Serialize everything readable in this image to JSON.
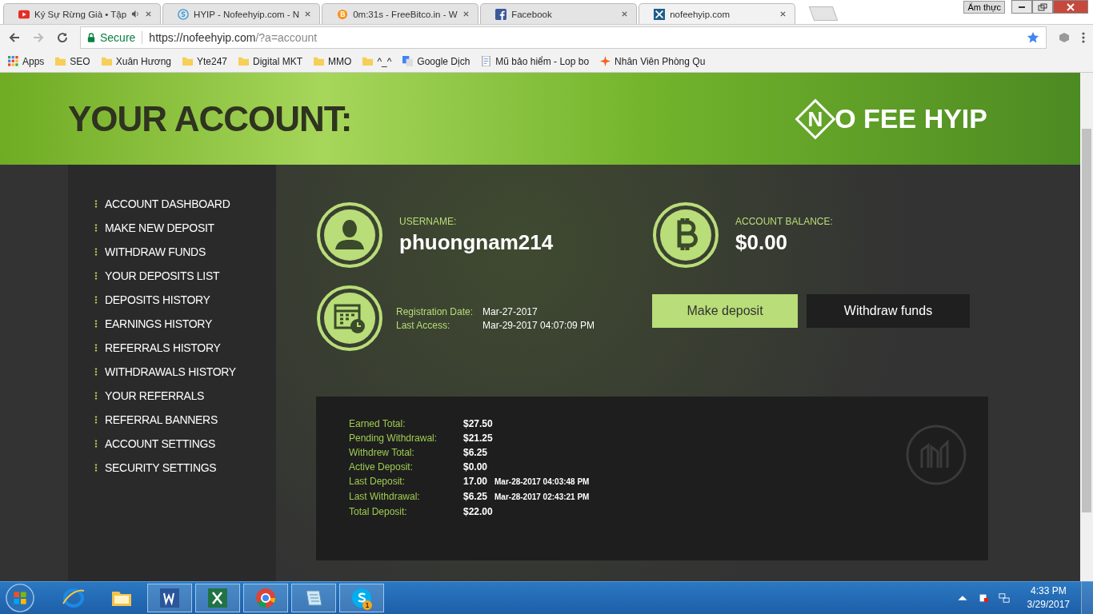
{
  "browser": {
    "tabs": [
      {
        "kind": "youtube",
        "title": "Ký Sự Rừng Già • Tập",
        "audio": true,
        "selected": false
      },
      {
        "kind": "s-logo",
        "title": "HYIP - Nofeehyip.com - N",
        "audio": false,
        "selected": false
      },
      {
        "kind": "bitcoin",
        "title": "0m:31s - FreeBitco.in - W",
        "audio": false,
        "selected": false
      },
      {
        "kind": "facebook",
        "title": "Facebook",
        "audio": false,
        "selected": false
      },
      {
        "kind": "x-logo",
        "title": "nofeehyip.com",
        "audio": false,
        "selected": true
      }
    ],
    "profile": "Ẩm thực",
    "secure": "Secure",
    "url_host": "https://nofeehyip.com",
    "url_path": "/?a=account",
    "bookmarks": [
      {
        "kind": "apps",
        "label": "Apps"
      },
      {
        "kind": "folder",
        "label": "SEO"
      },
      {
        "kind": "folder",
        "label": "Xuân Hương"
      },
      {
        "kind": "folder",
        "label": "Yte247"
      },
      {
        "kind": "folder",
        "label": "Digital MKT"
      },
      {
        "kind": "folder",
        "label": "MMO"
      },
      {
        "kind": "folder",
        "label": "^_^"
      },
      {
        "kind": "translate",
        "label": "Google Dịch"
      },
      {
        "kind": "page",
        "label": "Mũ bảo hiểm - Lop bo"
      },
      {
        "kind": "star",
        "label": "Nhân Viên Phòng Qu"
      }
    ]
  },
  "header": {
    "title": "YOUR ACCOUNT:",
    "logo_mark": "N",
    "logo_text": "O FEE HYIP"
  },
  "sidebar": {
    "items": [
      "ACCOUNT DASHBOARD",
      "MAKE NEW DEPOSIT",
      "WITHDRAW FUNDS",
      "YOUR DEPOSITS LIST",
      "DEPOSITS HISTORY",
      "EARNINGS HISTORY",
      "REFERRALS HISTORY",
      "WITHDRAWALS HISTORY",
      "YOUR REFERRALS",
      "REFERRAL BANNERS",
      "ACCOUNT SETTINGS",
      "SECURITY SETTINGS"
    ]
  },
  "account": {
    "username_label": "USERNAME:",
    "username": "phuongnam214",
    "balance_label": "ACCOUNT BALANCE:",
    "balance": "$0.00",
    "dates": [
      {
        "label": "Registration Date:",
        "value": "Mar-27-2017"
      },
      {
        "label": "Last Access:",
        "value": "Mar-29-2017 04:07:09 PM"
      }
    ],
    "buttons": [
      {
        "kind": "primary",
        "label": "Make deposit"
      },
      {
        "kind": "dark",
        "label": "Withdraw funds"
      }
    ]
  },
  "stats": [
    {
      "label": "Earned Total:",
      "value": "$27.50"
    },
    {
      "label": "Pending Withdrawal:",
      "value": "$21.25"
    },
    {
      "label": "Withdrew Total:",
      "value": "$6.25"
    },
    {
      "label": "Active Deposit:",
      "value": "$0.00"
    },
    {
      "label": "Last Deposit:",
      "value": "17.00",
      "note": "Mar-28-2017 04:03:48 PM"
    },
    {
      "label": "Last Withdrawal:",
      "value": "$6.25",
      "note": "Mar-28-2017 02:43:21 PM"
    },
    {
      "label": "Total Deposit:",
      "value": "$22.00"
    }
  ],
  "taskbar": {
    "apps": [
      {
        "kind": "ie",
        "running": false
      },
      {
        "kind": "explorer",
        "running": false
      },
      {
        "kind": "word",
        "running": true
      },
      {
        "kind": "excel",
        "running": true
      },
      {
        "kind": "chrome",
        "running": true
      },
      {
        "kind": "notepad",
        "running": true
      },
      {
        "kind": "skype",
        "running": true,
        "badge": "1"
      }
    ],
    "time": "4:33 PM",
    "date": "3/29/2017"
  }
}
